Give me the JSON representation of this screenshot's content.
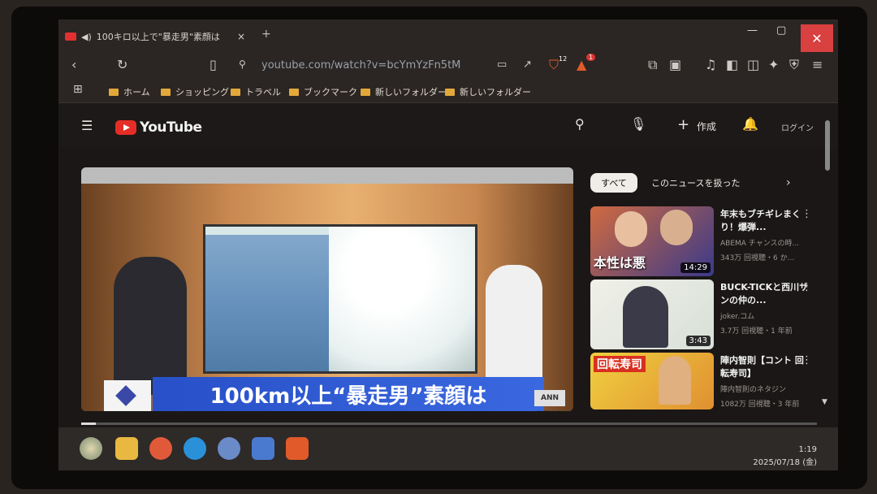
{
  "browser": {
    "tab_title": "100キロ以上で\"暴走男\"素顔は",
    "tab_close": "×",
    "new_tab": "+",
    "win_min": "—",
    "win_max": "▢",
    "win_close": "✕",
    "url": "youtube.com/watch?v=bcYmYzFn5tM",
    "shield_badge": "12",
    "rewards_badge": "1"
  },
  "bookmarks": [
    "ホーム",
    "ショッピング",
    "トラベル",
    "ブックマーク",
    "新しいフォルダー",
    "新しいフォルダー"
  ],
  "youtube": {
    "logo": "YouTube",
    "create": "作成",
    "login": "ログイン"
  },
  "video": {
    "caption": "100km以上“暴走男”素顔は",
    "network_logo": "ANN NEWS",
    "progress_fraction": 0.02
  },
  "filters": {
    "all": "すべて",
    "related": "このニュースを扱った"
  },
  "recommendations": [
    {
      "title": "年末もブチギレまくり！爆弾...",
      "channel": "ABEMA チャンスの時...",
      "meta": "343万 回視聴・6 か...",
      "duration": "14:29",
      "overlay": "本性は悪"
    },
    {
      "title": "BUCK-TICKと西川サンの仲の...",
      "channel": "joker.コム",
      "meta": "3.7万 回視聴・1 年前",
      "duration": "3:43",
      "overlay": ""
    },
    {
      "title": "陣内智則【コント 回転寿司】",
      "channel": "陣内智則のネタジン",
      "meta": "1082万 回視聴・3 年前",
      "duration": "",
      "overlay": "回転寿司"
    }
  ],
  "taskbar": {
    "time": "1:19",
    "date": "2025/07/18 (金)"
  }
}
